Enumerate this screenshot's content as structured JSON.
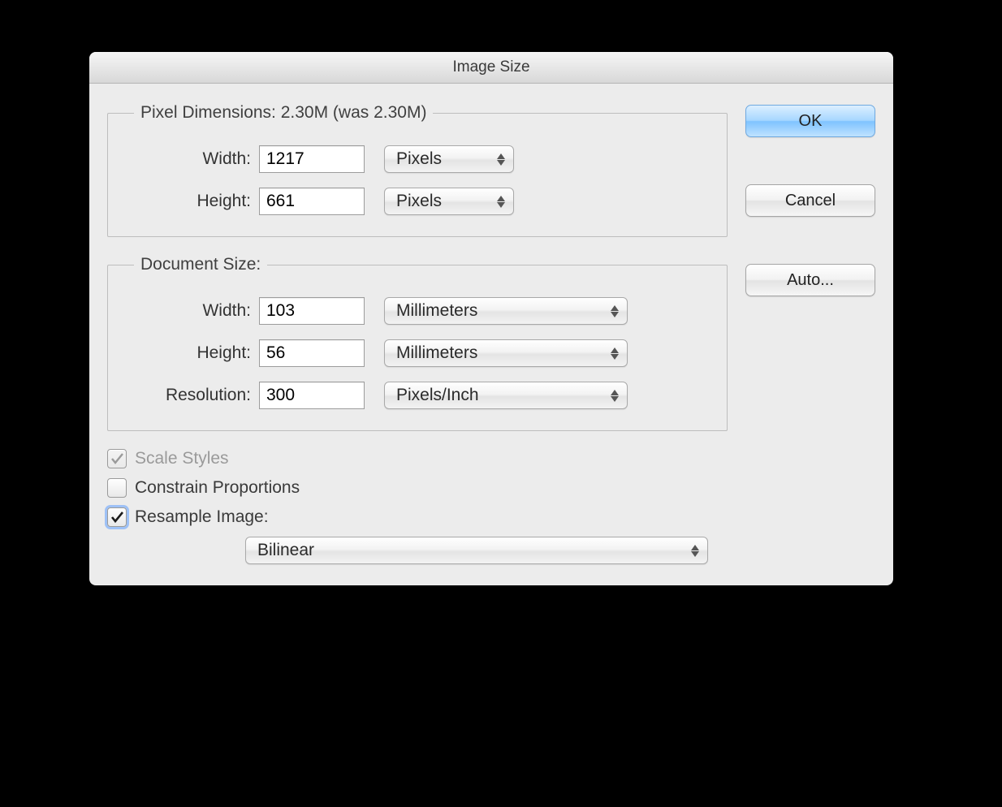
{
  "title": "Image Size",
  "pixel_dimensions": {
    "legend": "Pixel Dimensions:  2.30M (was 2.30M)",
    "width_label": "Width:",
    "width_value": "1217",
    "width_unit": "Pixels",
    "height_label": "Height:",
    "height_value": "661",
    "height_unit": "Pixels"
  },
  "document_size": {
    "legend": "Document Size:",
    "width_label": "Width:",
    "width_value": "103",
    "width_unit": "Millimeters",
    "height_label": "Height:",
    "height_value": "56",
    "height_unit": "Millimeters",
    "resolution_label": "Resolution:",
    "resolution_value": "300",
    "resolution_unit": "Pixels/Inch"
  },
  "options": {
    "scale_styles_label": "Scale Styles",
    "constrain_label": "Constrain Proportions",
    "resample_label": "Resample Image:",
    "resample_method": "Bilinear"
  },
  "buttons": {
    "ok": "OK",
    "cancel": "Cancel",
    "auto": "Auto..."
  }
}
